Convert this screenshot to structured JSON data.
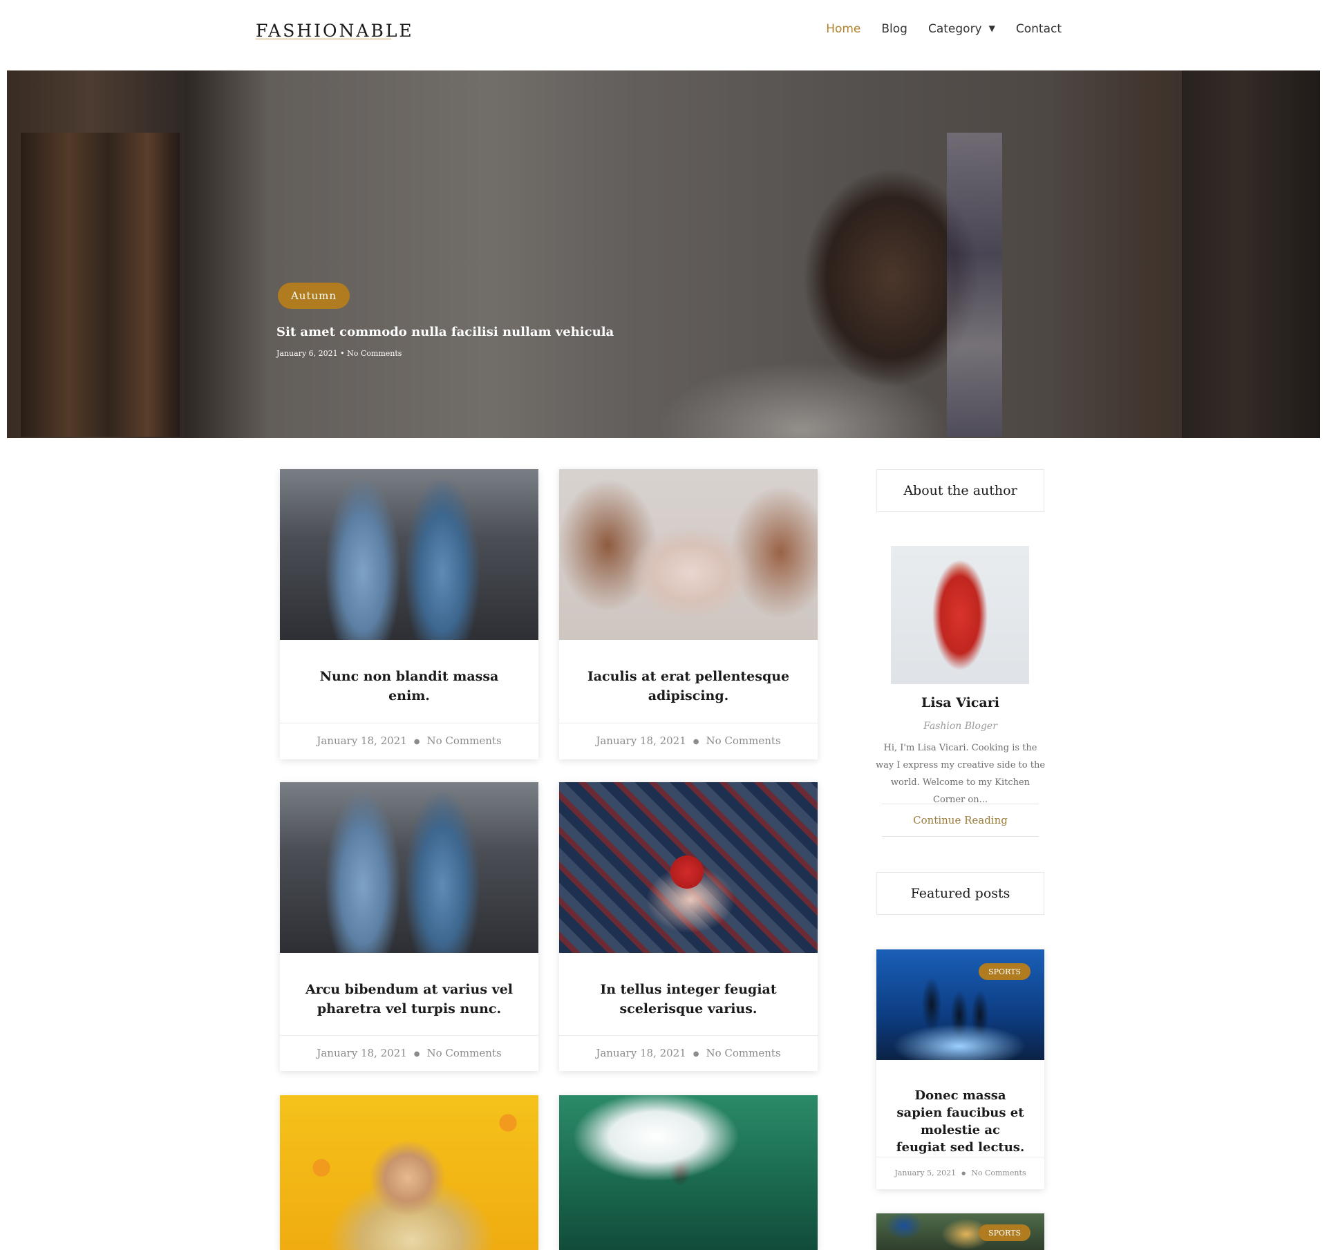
{
  "header": {
    "logo": "FASHIONABLE",
    "nav": [
      {
        "label": "Home"
      },
      {
        "label": "Blog"
      },
      {
        "label": "Category"
      },
      {
        "label": "Contact"
      }
    ]
  },
  "hero": {
    "badge": "Autumn",
    "title": "Sit amet commodo nulla facilisi nullam vehicula",
    "meta": "January 6, 2021 • No Comments"
  },
  "posts": [
    {
      "title": "Nunc non blandit massa enim.",
      "date": "January 18, 2021",
      "comments": "No Comments"
    },
    {
      "title": "Iaculis at erat pellentesque adipiscing.",
      "date": "January 18, 2021",
      "comments": "No Comments"
    },
    {
      "title": "Arcu bibendum at varius vel pharetra vel turpis nunc.",
      "date": "January 18, 2021",
      "comments": "No Comments"
    },
    {
      "title": "In tellus integer feugiat scelerisque varius.",
      "date": "January 18, 2021",
      "comments": "No Comments"
    }
  ],
  "sidebar": {
    "about_title": "About the author",
    "author_name": "Lisa Vicari",
    "author_role": "Fashion Bloger",
    "author_bio": "Hi, I'm Lisa Vicari. Cooking is the way I express my creative side to the world. Welcome to my Kitchen Corner on...",
    "continue_label": "Continue Reading",
    "featured_title": "Featured posts",
    "featured": [
      {
        "badge": "SPORTS",
        "title": "Donec massa sapien faucibus et molestie ac feugiat sed lectus.",
        "date": "January 5, 2021",
        "comments": "No Comments"
      },
      {
        "badge": "SPORTS"
      }
    ]
  },
  "colors": {
    "accent": "#b07c1f",
    "nav_active": "#b0822b",
    "link": "#9a7d3b"
  }
}
